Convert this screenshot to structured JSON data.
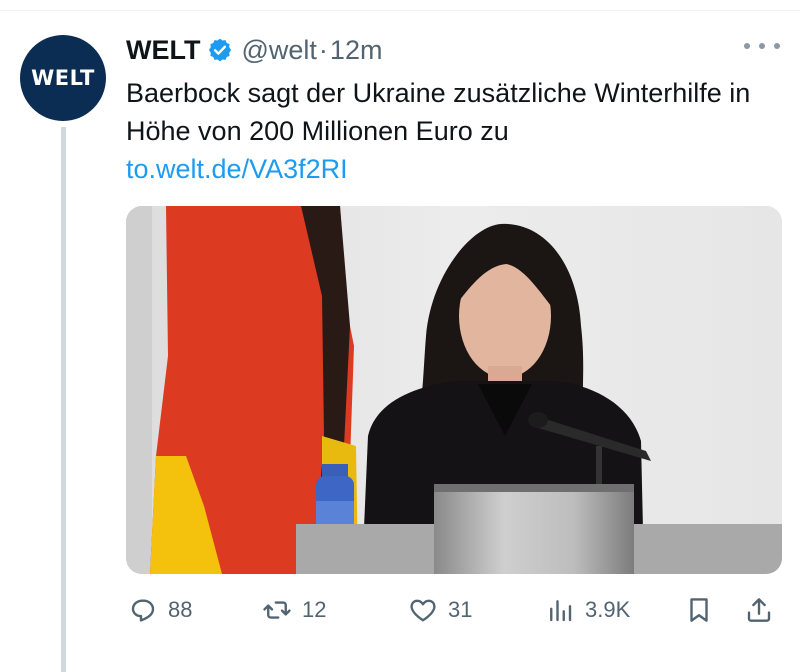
{
  "tweet": {
    "avatar_text": "WELT",
    "name": "WELT",
    "handle": "@welt",
    "separator": "·",
    "time": "12m",
    "text": "Baerbock sagt der Ukraine zusätzliche Winterhilfe in Höhe von 200 Millionen Euro zu",
    "link": "to.welt.de/VA3f2RI",
    "media_icon": "photo-media"
  },
  "actions": {
    "replies": "88",
    "retweets": "12",
    "likes": "31",
    "views": "3.9K"
  },
  "colors": {
    "link": "#1d9bf0",
    "verified": "#1d9bf0",
    "muted": "#536471",
    "avatar_bg": "#0b2d53"
  }
}
